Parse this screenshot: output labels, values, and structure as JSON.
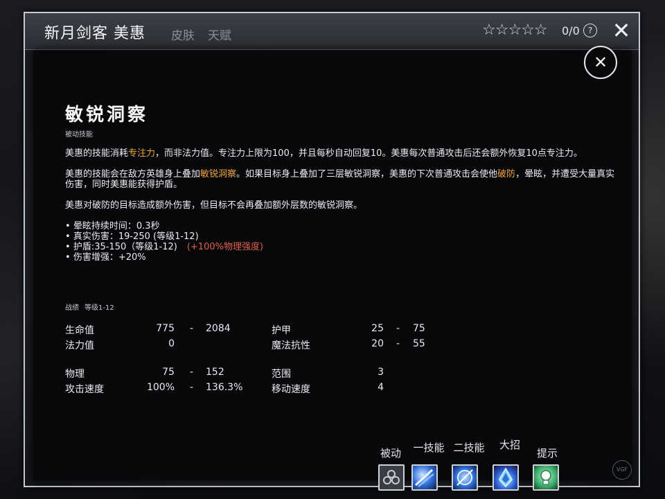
{
  "header": {
    "hero_name": "新月剑客 美惠",
    "tabs": [
      "皮肤",
      "天赋"
    ],
    "stars": "☆☆☆☆☆",
    "rating": "0/0",
    "help": "?",
    "close": "✕"
  },
  "ability": {
    "title": "敏锐洞察",
    "type": "被动技能",
    "para1_a": "美惠的技能消耗",
    "para1_hl": "专注力",
    "para1_b": "，而非法力值。专注力上限为100，并且每秒自动回复10。美惠每次普通攻击后还会额外恢复10点专注力。",
    "para2_a": "美惠的技能会在敌方英雄身上叠加",
    "para2_hl1": "敏锐洞察",
    "para2_b": "。如果目标身上叠加了三层敏锐洞察，美惠的下次普通攻击会使他",
    "para2_hl2": "破防",
    "para2_c": "，晕眩，并遭受大量真实伤害，同时美惠能获得护盾。",
    "para3": "美惠对破防的目标造成额外伤害，但目标不会再叠加额外层数的敏锐洞察。",
    "bullets": {
      "stun": "晕眩持续时间：0.3秒",
      "true_dmg": "真实伤害：19-250 (等级1-12)",
      "shield": "护盾:35-150（等级1-12)",
      "shield_scale": "(+100%物理强度)",
      "dmg_boost": "伤害增强：+20%"
    },
    "close": "✕"
  },
  "stats": {
    "heading": "战绩",
    "level_range": "等级1-12",
    "dash": "-",
    "rows": [
      {
        "label": "生命值",
        "min": "775",
        "max": "2084"
      },
      {
        "label": "法力值",
        "min": "0",
        "max": ""
      },
      {
        "label": "物理",
        "min": "75",
        "max": "152"
      },
      {
        "label": "攻击速度",
        "min": "100%",
        "max": "136.3%"
      },
      {
        "label": "护甲",
        "min": "25",
        "max": "75"
      },
      {
        "label": "魔法抗性",
        "min": "20",
        "max": "55"
      },
      {
        "label": "范围",
        "min": "3",
        "max": ""
      },
      {
        "label": "移动速度",
        "min": "4",
        "max": ""
      }
    ]
  },
  "abilities_bar": {
    "labels": [
      "被动",
      "一技能",
      "二技能",
      "大招",
      "提示"
    ],
    "icons": [
      "passive-icon",
      "skill1-icon",
      "skill2-icon",
      "ultimate-icon",
      "hint-icon"
    ],
    "colors": {
      "accent": "#f1a43c",
      "scaling": "#e3604a",
      "slot_blue": "#2f6fd8",
      "hint_green": "#3aa86a"
    }
  },
  "watermark": "VGF"
}
